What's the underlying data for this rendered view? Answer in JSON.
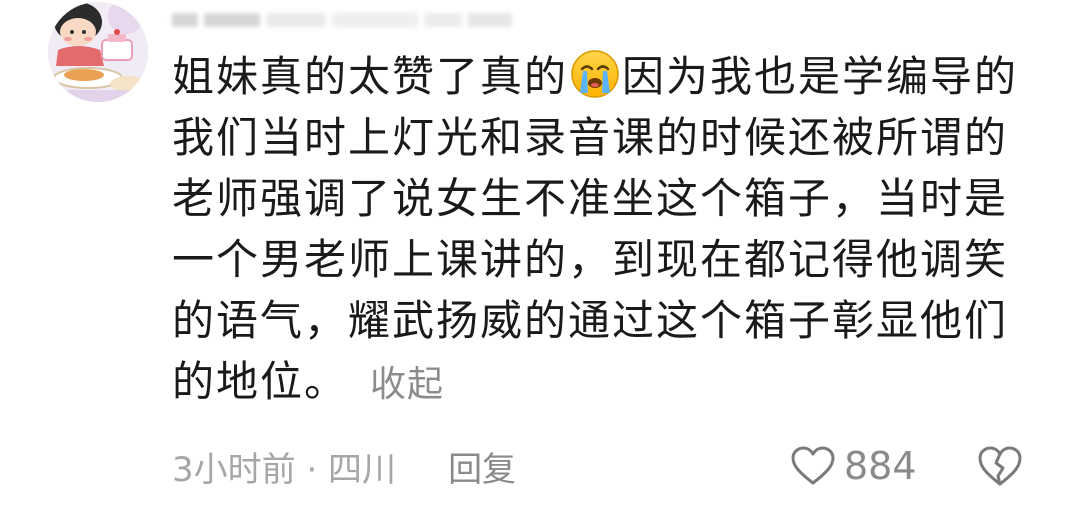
{
  "comment": {
    "lines": [
      [
        "姐妹真的太赞了真的",
        "因为我也是学编导的"
      ],
      "我们当时上灯光和录音课的时候还被所谓的",
      "老师强调了说女生不准坐这个箱子，当时是",
      "一个男老师上课讲的，到现在都记得他调笑",
      "的语气，耀武扬威的通过这个箱子彰显他们",
      "的地位。"
    ],
    "emoji_icon": "crying-face-emoji",
    "collapse_label": "收起",
    "time_location": "3小时前 · 四川",
    "reply_label": "回复",
    "like_count": "884",
    "icons": {
      "avatar": "cartoon-girl-avatar",
      "like": "heart-outline-icon",
      "dislike": "broken-heart-icon"
    },
    "colors": {
      "text": "#1a1a1a",
      "secondary": "#8c8c8c",
      "meta": "#a6a6a6"
    }
  }
}
